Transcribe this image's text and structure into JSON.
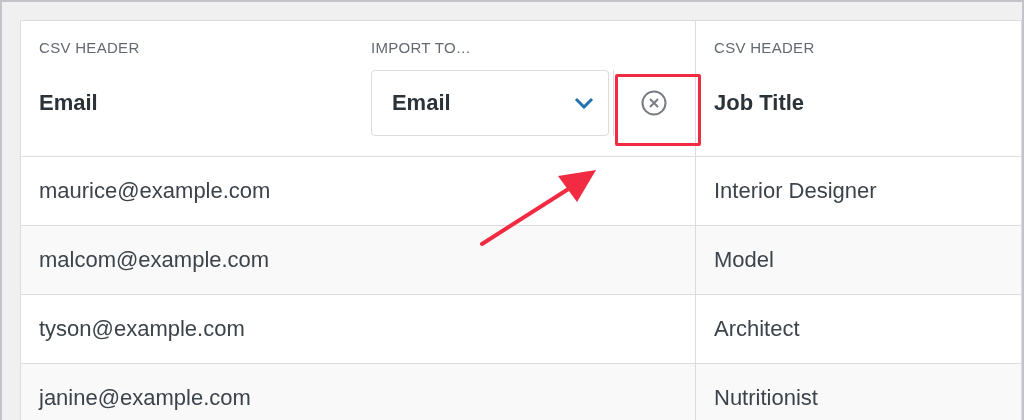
{
  "columns": [
    {
      "header_label": "CSV HEADER",
      "header": "Email",
      "import_label": "IMPORT TO…",
      "mapping": "Email"
    },
    {
      "header_label": "CSV HEADER",
      "header": "Job Title"
    }
  ],
  "rows": [
    [
      "maurice@example.com",
      "Interior Designer"
    ],
    [
      "malcom@example.com",
      "Model"
    ],
    [
      "tyson@example.com",
      "Architect"
    ],
    [
      "janine@example.com",
      "Nutritionist"
    ]
  ]
}
